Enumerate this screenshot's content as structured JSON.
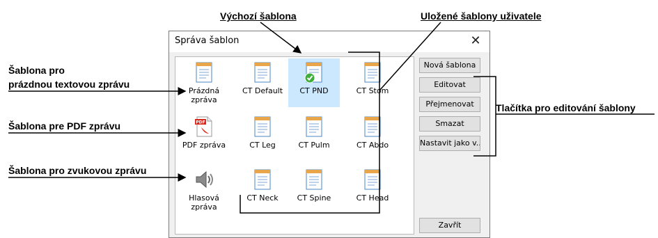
{
  "callouts": {
    "default_template": "Výchozí šablona",
    "user_templates": "Uložené šablony uživatele",
    "blank_text_line1": "Šablona pro",
    "blank_text_line2": "prázdnou textovou zprávu",
    "pdf_template": "Šablona pre PDF zprávu",
    "audio_template": "Šablona pro zvukovou zprávu",
    "edit_buttons": "Tlačítka pro editování šablony"
  },
  "dialog": {
    "title": "Správa šablon",
    "close": "✕",
    "templates": [
      {
        "line1": "Prázdná",
        "line2": "zpráva",
        "icon": "text-document-icon"
      },
      {
        "line1": "CT Default",
        "line2": "",
        "icon": "text-document-icon"
      },
      {
        "line1": "CT PND",
        "line2": "",
        "icon": "default-check-document-icon",
        "selected": true
      },
      {
        "line1": "CT Stom",
        "line2": "",
        "icon": "text-document-icon"
      },
      {
        "line1": "PDF zpráva",
        "line2": "",
        "icon": "pdf-document-icon"
      },
      {
        "line1": "CT Leg",
        "line2": "",
        "icon": "text-document-icon"
      },
      {
        "line1": "CT Pulm",
        "line2": "",
        "icon": "text-document-icon"
      },
      {
        "line1": "CT Abdo",
        "line2": "",
        "icon": "text-document-icon"
      },
      {
        "line1": "Hlasová",
        "line2": "zpráva",
        "icon": "speaker-icon"
      },
      {
        "line1": "CT Neck",
        "line2": "",
        "icon": "text-document-icon"
      },
      {
        "line1": "CT Spine",
        "line2": "",
        "icon": "text-document-icon"
      },
      {
        "line1": "CT Head",
        "line2": "",
        "icon": "text-document-icon"
      }
    ],
    "buttons": {
      "new": "Nová šablona",
      "edit": "Editovat",
      "rename": "Přejmenovat",
      "delete": "Smazat",
      "set_default": "Nastavit jako v...",
      "close": "Zavřít"
    }
  },
  "colors": {
    "selection": "#cce8ff",
    "pdf_red": "#d9261c",
    "doc_orange": "#e8a54a",
    "doc_blue": "#4a86c5"
  }
}
